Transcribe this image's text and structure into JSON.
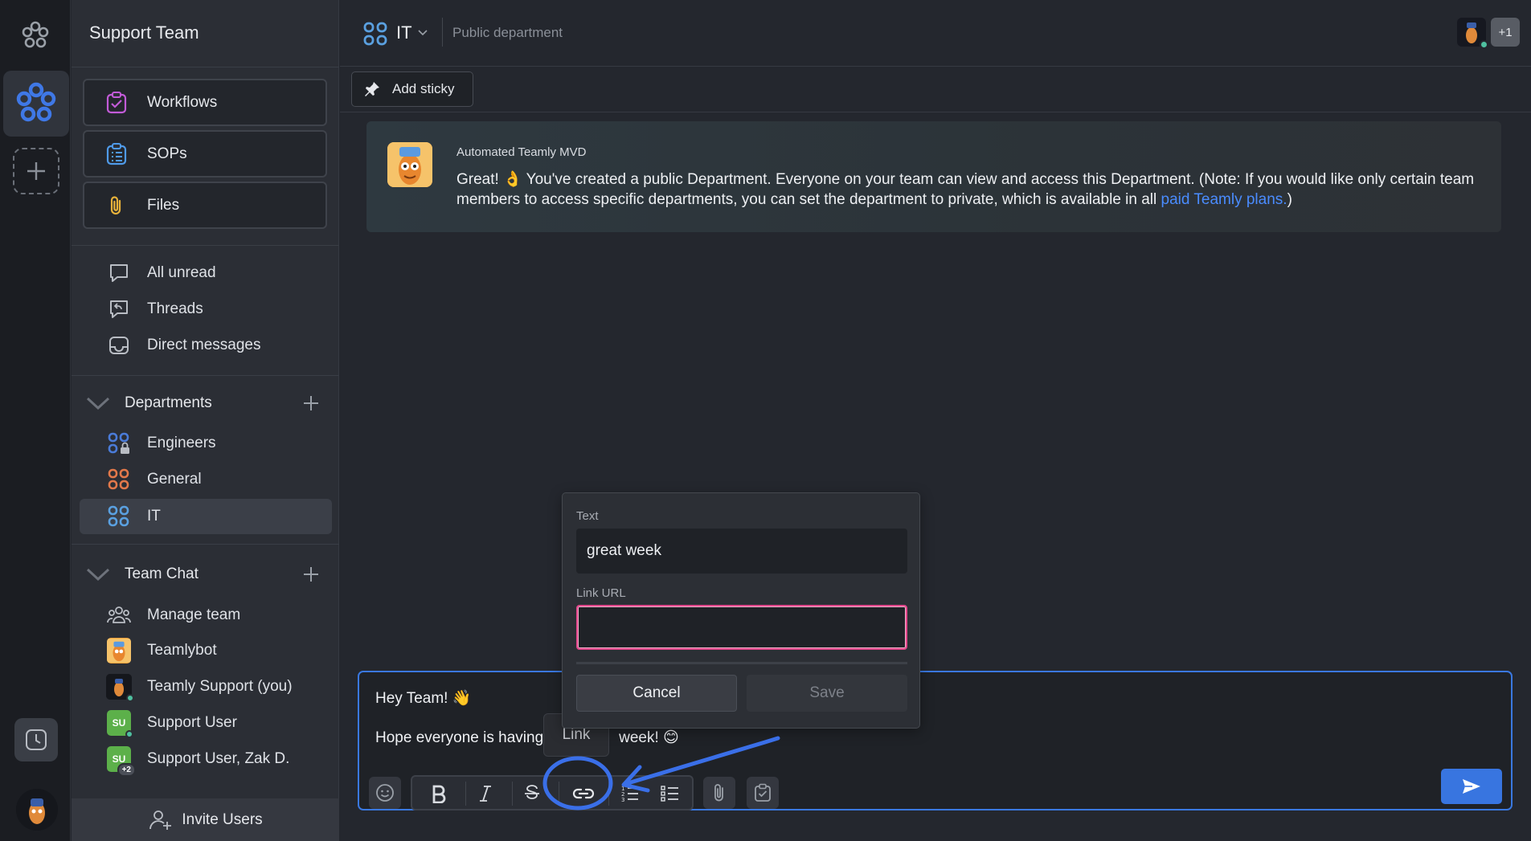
{
  "app": {
    "team_name": "Support Team"
  },
  "sidebar": {
    "big_buttons": [
      {
        "label": "Workflows",
        "icon": "workflow-icon"
      },
      {
        "label": "SOPs",
        "icon": "sop-icon"
      },
      {
        "label": "Files",
        "icon": "paperclip-icon"
      }
    ],
    "quick_links": [
      {
        "label": "All unread",
        "icon": "chat-bubble-icon"
      },
      {
        "label": "Threads",
        "icon": "threads-icon"
      },
      {
        "label": "Direct messages",
        "icon": "inbox-icon"
      }
    ],
    "departments": {
      "title": "Departments",
      "items": [
        {
          "label": "Engineers",
          "icon": "department-locked-icon",
          "color": "#4a7bd8"
        },
        {
          "label": "General",
          "icon": "department-icon",
          "color": "#e2784a"
        },
        {
          "label": "IT",
          "icon": "department-icon",
          "color": "#5aa0e0",
          "active": true
        }
      ]
    },
    "team_chat": {
      "title": "Team Chat",
      "items": [
        {
          "label": "Manage team",
          "icon": "people-icon"
        },
        {
          "label": "Teamlybot",
          "icon": "teamlybot-avatar"
        },
        {
          "label": "Teamly Support (you)",
          "icon": "user-avatar"
        },
        {
          "label": "Support User",
          "initials": "SU",
          "color": "#5cb04a"
        },
        {
          "label": "Support User, Zak D.",
          "initials": "SU",
          "color": "#5cb04a",
          "badge": "+2"
        }
      ]
    },
    "invite_label": "Invite Users"
  },
  "header": {
    "department": "IT",
    "subtitle": "Public department",
    "member_overflow": "+1"
  },
  "sticky": {
    "label": "Add sticky"
  },
  "message": {
    "author": "Automated Teamly MVD",
    "text": "Great! 👌 You've created a public Department. Everyone on your team can view and access this Department. (Note: If you would like only certain team members to access specific departments, you can set the department to private, which is available in all ",
    "link_text": "paid Teamly plans.",
    "text_end": ")"
  },
  "composer": {
    "line1": "Hey Team! 👋",
    "line2_a": "Hope everyone is having",
    "line2_b": "week! 😊",
    "toolbar": [
      "emoji-icon",
      "bold-icon",
      "italic-icon",
      "strikethrough-icon",
      "link-icon",
      "ordered-list-icon",
      "bullet-list-icon",
      "paperclip-icon",
      "task-icon",
      "send-icon"
    ]
  },
  "tooltip": {
    "label": "Link"
  },
  "link_popup": {
    "text_label": "Text",
    "text_value": "great week",
    "url_label": "Link URL",
    "url_value": "",
    "cancel_label": "Cancel",
    "save_label": "Save"
  },
  "colors": {
    "accent": "#3875e0",
    "annotation": "#3a6fe8",
    "url_focus": "#e2478c"
  }
}
